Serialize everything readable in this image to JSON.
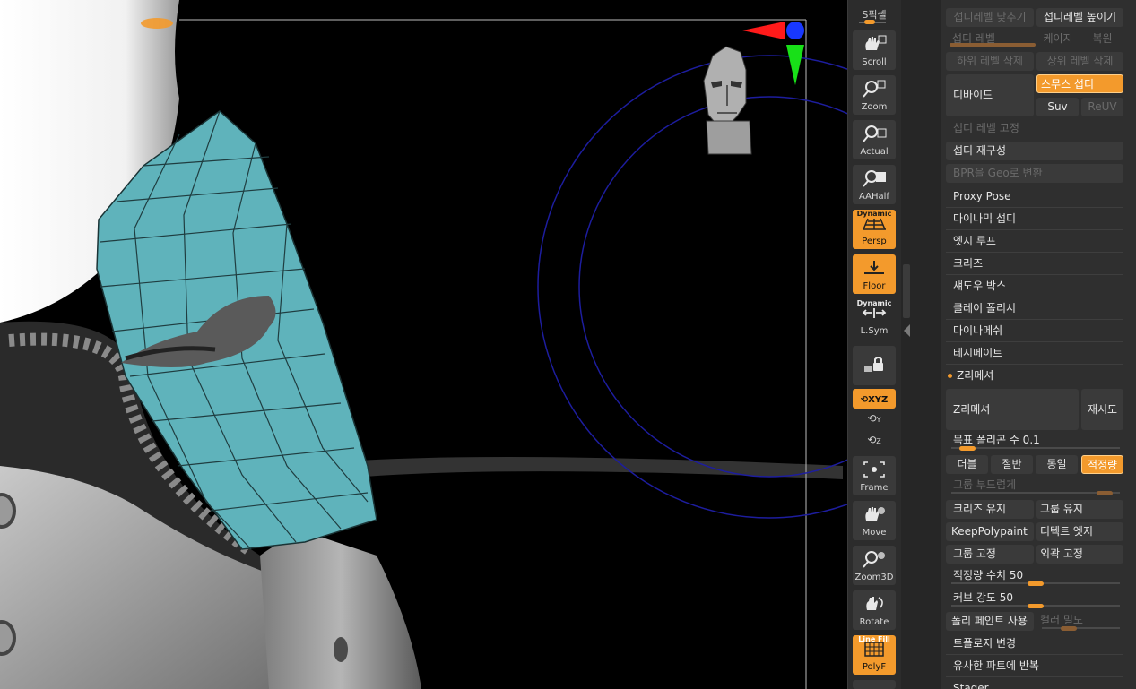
{
  "colors": {
    "accent": "#f39a2c",
    "panel_bg": "#2f2f2f",
    "button_bg": "#3a3a3a",
    "mesh_teal": "#5fb3bb",
    "viewport_bg": "#000000",
    "gizmo_x": "#ff1a1a",
    "gizmo_y": "#18e018",
    "gizmo_z": "#1838ff"
  },
  "shelf": {
    "s_pixel": "S픽셀",
    "scroll": "Scroll",
    "zoom": "Zoom",
    "actual": "Actual",
    "aahalf": "AAHalf",
    "persp_sup": "Dynamic",
    "persp": "Persp",
    "floor": "Floor",
    "lsym_sup": "Dynamic",
    "lsym": "L.Sym",
    "lock_icon": "lock-camera-icon",
    "xyz": "XYZ",
    "y_rot": "Y",
    "z_rot": "Z",
    "frame": "Frame",
    "move": "Move",
    "zoom3d": "Zoom3D",
    "rotate": "Rotate",
    "polyf_sup": "Line Fill",
    "polyf": "PolyF"
  },
  "panel": {
    "subdiv_lower": "섭디레벨 낮추기",
    "subdiv_higher": "섭디레벨 높이기",
    "subdiv_level": "섭디 레벨",
    "cage": "케이지",
    "restore": "복원",
    "del_lower": "하위 레벨 삭제",
    "del_higher": "상위 레벨 삭제",
    "divide": "디바이드",
    "smooth_subdiv": "스무스 섭디",
    "suv": "Suv",
    "reuv": "ReUV",
    "fix_subdiv": "섭디 레벨 고정",
    "rebuild_subdiv": "섭디 재구성",
    "bpr_to_geo": "BPR을 Geo로 변환",
    "proxy_pose": "Proxy Pose",
    "dynamic_subdiv": "다이나믹 섭디",
    "edge_loop": "엣지 루프",
    "crease": "크리즈",
    "shadow_box": "섀도우 박스",
    "clay_polish": "클레이 폴리시",
    "dynamesh": "다이나메쉬",
    "tessimate": "테시메이트",
    "zremesher_section": "Z리메셔",
    "zremesher_btn": "Z리메셔",
    "retry": "재시도",
    "target_poly": "목표 폴리곤 수 0.1",
    "target_poly_value": 0.05,
    "double": "더블",
    "half": "절반",
    "same": "동일",
    "adaptive": "적정량",
    "group_smooth": "그룹 부드럽게",
    "group_smooth_value": 0.95,
    "keep_crease": "크리즈 유지",
    "keep_groups": "그룹 유지",
    "keep_polypaint": "KeepPolypaint",
    "detect_edges": "디텍트 엣지",
    "freeze_groups": "그룹 고정",
    "freeze_border": "외곽 고정",
    "adaptive_size": "적정량 수치 50",
    "adaptive_size_value": 0.5,
    "curve_strength": "커브 강도 50",
    "curve_strength_value": 0.5,
    "use_polypaint": "폴리 페인트 사용",
    "color_density": "컬러 밀도",
    "color_density_value": 0.3,
    "change_topology": "토폴로지 변경",
    "repeat_similar": "유사한 파트에 반복",
    "next_section": "Stager"
  }
}
